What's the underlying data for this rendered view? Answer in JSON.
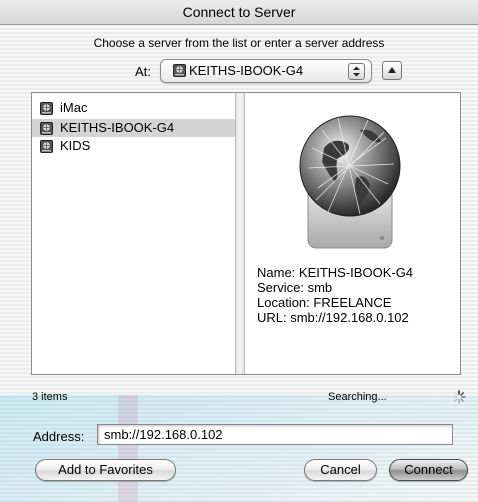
{
  "window": {
    "title": "Connect to Server"
  },
  "instruction": "Choose a server from the list or enter a server address",
  "at_selector": {
    "label": "At:",
    "value": "KEITHS-IBOOK-G4"
  },
  "server_list": [
    {
      "label": "iMac",
      "selected": false
    },
    {
      "label": "KEITHS-IBOOK-G4",
      "selected": true
    },
    {
      "label": "KIDS",
      "selected": false
    }
  ],
  "details": {
    "name": "Name: KEITHS-IBOOK-G4",
    "service": "Service: smb",
    "location": "Location: FREELANCE",
    "url": "URL: smb://192.168.0.102"
  },
  "status": {
    "count": "3 items",
    "searching": "Searching..."
  },
  "address": {
    "label": "Address:",
    "value": "smb://192.168.0.102"
  },
  "buttons": {
    "add_to_favorites": "Add to Favorites",
    "cancel": "Cancel",
    "connect": "Connect"
  },
  "icons": {
    "server_disk": "network-disk-icon",
    "globe": "globe-server-icon",
    "spinner": "progress-spinner-icon"
  }
}
